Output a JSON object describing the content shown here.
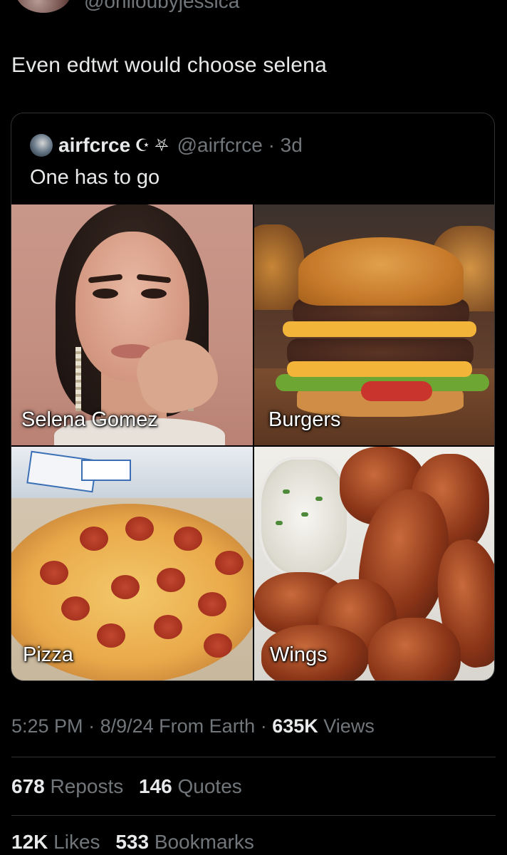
{
  "top": {
    "handle_cutoff": "@onlloubyjessica"
  },
  "tweet": {
    "text": "Even edtwt would choose selena"
  },
  "quote": {
    "name": "airfcrce",
    "emojis": "☪ ⛧",
    "handle_time": "@airfcrce · 3d",
    "text": "One has to go",
    "tiles": [
      {
        "label": "Selena Gomez"
      },
      {
        "label": "Burgers"
      },
      {
        "label": "Pizza"
      },
      {
        "label": "Wings"
      }
    ]
  },
  "meta": {
    "time": "5:25 PM",
    "date": "8/9/24",
    "source": "From Earth",
    "views_count": "635K",
    "views_label": "Views"
  },
  "stats": {
    "reposts_count": "678",
    "reposts_label": "Reposts",
    "quotes_count": "146",
    "quotes_label": "Quotes",
    "likes_count": "12K",
    "likes_label": "Likes",
    "bookmarks_count": "533",
    "bookmarks_label": "Bookmarks"
  }
}
